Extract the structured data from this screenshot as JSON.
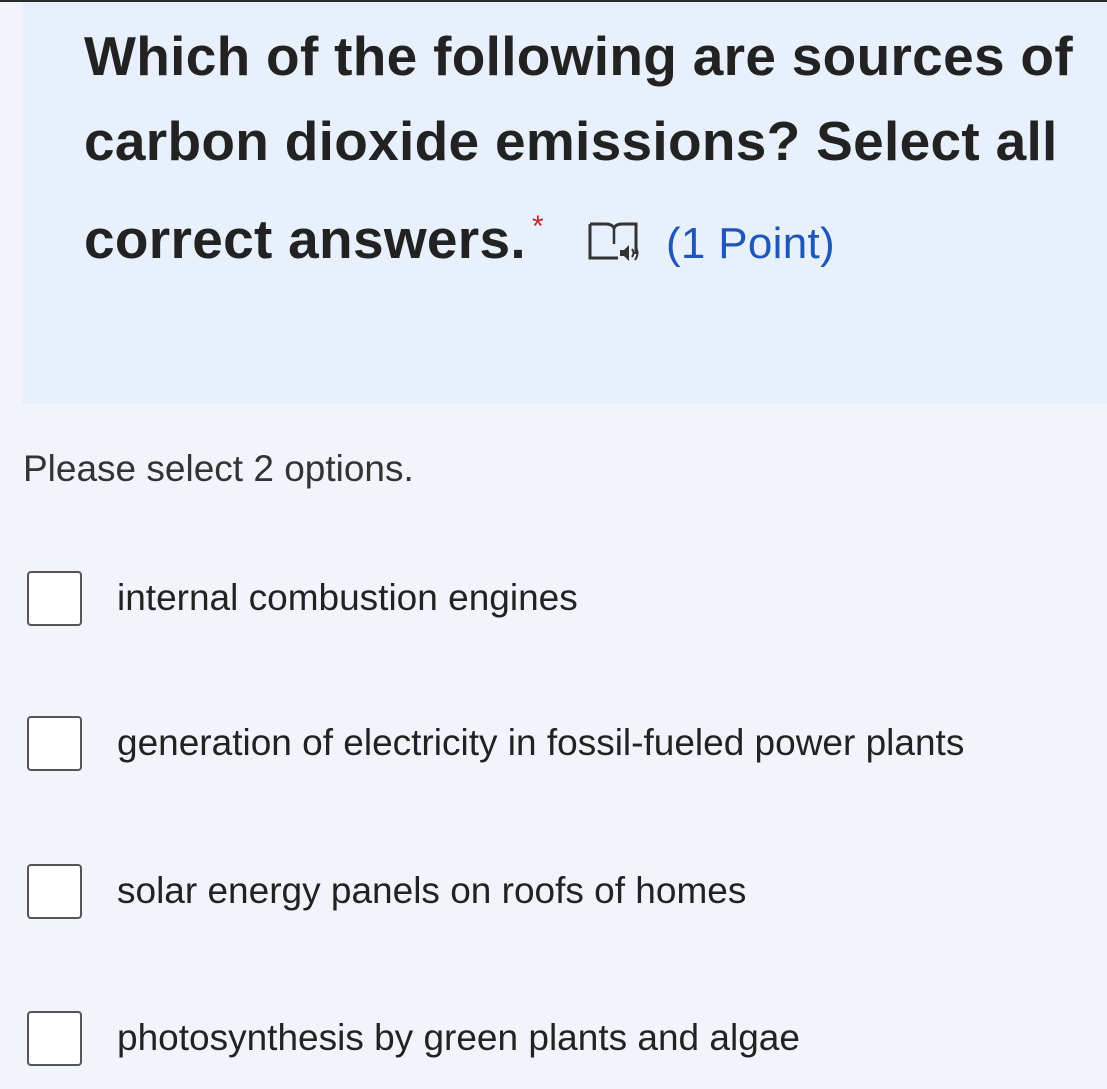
{
  "question": {
    "title": "Which of the following are sources of carbon dioxide emissions? Select all correct answers.",
    "required_marker": "*",
    "points_label": "(1 Point)",
    "immersive_reader_icon": "immersive-reader-icon"
  },
  "instruction": "Please select 2 options.",
  "options": [
    {
      "label": "internal combustion engines",
      "checked": false
    },
    {
      "label": "generation of electricity in fossil-fueled power plants",
      "checked": false
    },
    {
      "label": "solar energy panels on roofs of homes",
      "checked": false
    },
    {
      "label": "photosynthesis by green plants and algae",
      "checked": false
    }
  ],
  "colors": {
    "required": "#c4262e",
    "points": "#1f57b8",
    "header_bg": "#e8f0fb",
    "page_bg": "#f1f5fb"
  }
}
